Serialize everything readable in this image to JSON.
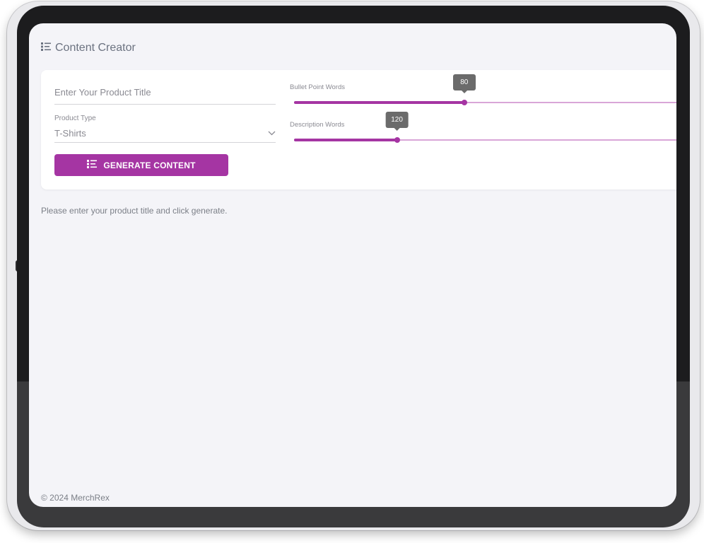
{
  "app": {
    "title": "Content Creator",
    "title_icon": "list-icon"
  },
  "form": {
    "title_placeholder": "Enter Your Product Title",
    "title_value": "",
    "product_type": {
      "label": "Product Type",
      "selected": "T-Shirts",
      "icon": "chevron-down-icon"
    },
    "generate_button": {
      "label": "GENERATE CONTENT",
      "icon": "list-icon"
    }
  },
  "sliders": {
    "bullet": {
      "label": "Bullet Point Words",
      "value": "80",
      "fraction": 0.43
    },
    "description": {
      "label": "Description Words",
      "value": "120",
      "fraction": 0.26
    }
  },
  "colors": {
    "accent": "#a535a3",
    "track_light": "#d9a6d8"
  },
  "status_message": "Please enter your product title and click generate.",
  "footer": "© 2024 MerchRex"
}
